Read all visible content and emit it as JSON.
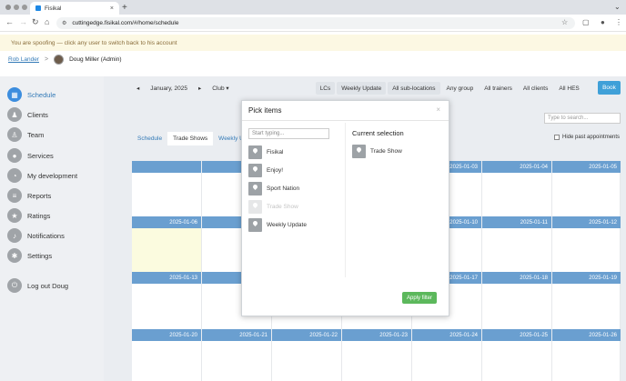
{
  "browser": {
    "tab_title": "Fisikal",
    "tab_close": "×",
    "new_tab": "+",
    "url": "cuttingedge.fisikal.com/#/home/schedule"
  },
  "spoof_banner": "You are spoofing — click any user to switch back to his account",
  "userbar": {
    "link": "Rob Lander",
    "separator": ">",
    "current_user": "Doug Miller (Admin)"
  },
  "sidebar": {
    "items": [
      {
        "label": "Schedule",
        "icon": "calendar-icon",
        "active": true
      },
      {
        "label": "Clients",
        "icon": "people-icon"
      },
      {
        "label": "Team",
        "icon": "person-icon"
      },
      {
        "label": "Services",
        "icon": "circle-icon"
      },
      {
        "label": "My development",
        "icon": "gauge-icon"
      },
      {
        "label": "Reports",
        "icon": "list-icon"
      },
      {
        "label": "Ratings",
        "icon": "star-icon"
      },
      {
        "label": "Notifications",
        "icon": "bell-icon"
      },
      {
        "label": "Settings",
        "icon": "gear-icon"
      },
      {
        "label": "Log out Doug",
        "icon": "power-icon"
      }
    ]
  },
  "filterbar": {
    "prev": "◂",
    "month": "January, 2025",
    "next": "▸",
    "club": "Club ▾",
    "lcs": "LCs",
    "weekly": "Weekly Update",
    "subloc": "All sub-locations",
    "group": "Any group",
    "trainers": "All trainers",
    "clients": "All clients",
    "hes": "All HES"
  },
  "book": "Book",
  "search_placeholder": "Type to search...",
  "hide_past": "Hide past appointments",
  "views": {
    "schedule": "Schedule",
    "trade": "Trade Shows",
    "weekly": "Weekly Update"
  },
  "calendar": {
    "weeks": [
      [
        "",
        "",
        "",
        "",
        "2025-01-03",
        "2025-01-04",
        "2025-01-05"
      ],
      [
        "2025-01-06",
        "",
        "",
        "",
        "2025-01-10",
        "2025-01-11",
        "2025-01-12"
      ],
      [
        "2025-01-13",
        "",
        "",
        "",
        "2025-01-17",
        "2025-01-18",
        "2025-01-19"
      ],
      [
        "2025-01-20",
        "2025-01-21",
        "2025-01-22",
        "2025-01-23",
        "2025-01-24",
        "2025-01-25",
        "2025-01-26"
      ]
    ]
  },
  "modal": {
    "title": "Pick items",
    "close": "×",
    "placeholder": "Start typing...",
    "current_title": "Current selection",
    "options": [
      {
        "label": "Fisikal",
        "disabled": false
      },
      {
        "label": "Enjoy!",
        "disabled": false
      },
      {
        "label": "Sport Nation",
        "disabled": false
      },
      {
        "label": "Trade Show",
        "disabled": true
      },
      {
        "label": "Weekly Update",
        "disabled": false
      }
    ],
    "selected": [
      "Trade Show"
    ],
    "apply": "Apply filter"
  }
}
